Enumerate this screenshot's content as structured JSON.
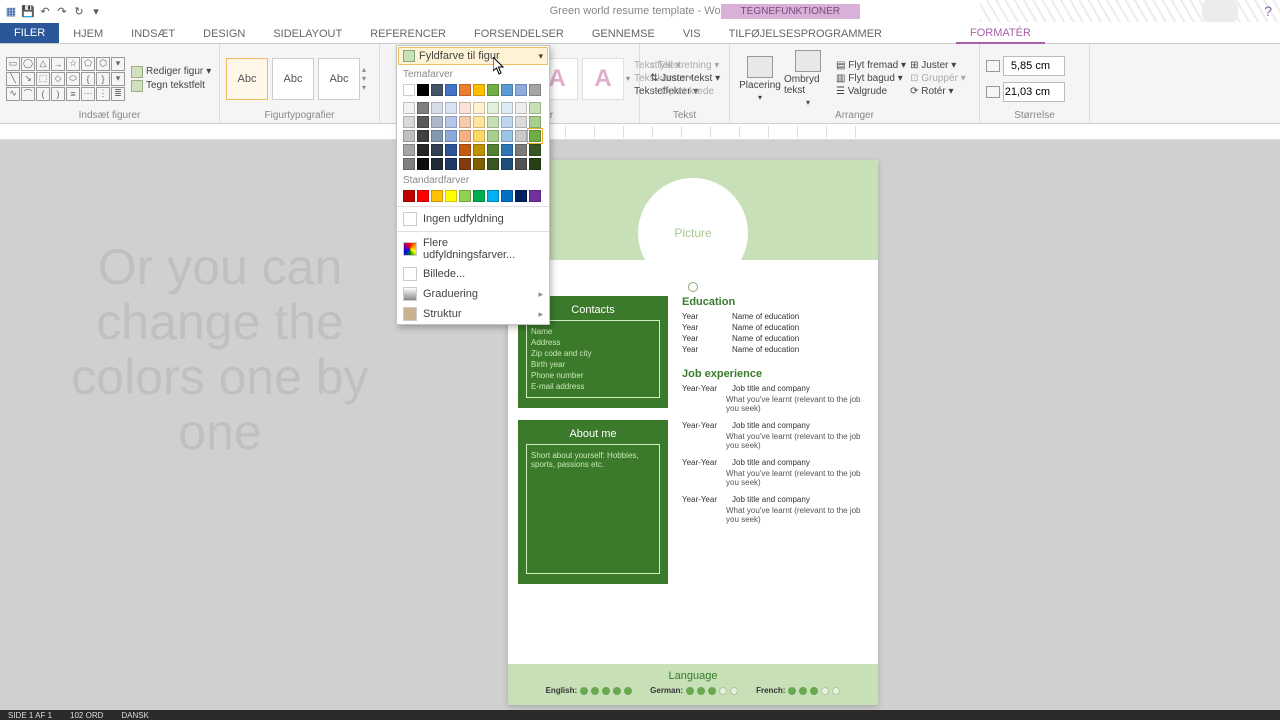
{
  "titlebar": {
    "title": "Green world resume template - Word",
    "context_tab": "TEGNEFUNKTIONER",
    "help": "?"
  },
  "tabs": {
    "file": "FILER",
    "items": [
      "HJEM",
      "INDSÆT",
      "DESIGN",
      "SIDELAYOUT",
      "REFERENCER",
      "FORSENDELSER",
      "GENNEMSE",
      "VIS",
      "TILFØJELSESPROGRAMMER"
    ],
    "active": "FORMATÉR"
  },
  "ribbon": {
    "groups": {
      "insert_shapes": {
        "label": "Indsæt figurer",
        "edit": "Rediger figur",
        "textbox": "Tegn tekstfelt"
      },
      "shape_styles": {
        "label": "Figurtypografier",
        "abc": "Abc"
      },
      "wordart": {
        "label": "WordArt-typografier",
        "glyph": "A",
        "fill": "Tekstfyld",
        "outline": "Tekstkontur",
        "effects": "Teksteffekter"
      },
      "text": {
        "label": "Tekst",
        "direction": "Tekstretning",
        "align": "Juster tekst",
        "link": "Opret kæde"
      },
      "arrange": {
        "label": "Arranger",
        "position": "Placering",
        "wrap": "Ombryd tekst",
        "forward": "Flyt fremad",
        "backward": "Flyt bagud",
        "selection": "Valgrude",
        "alignbtn": "Juster",
        "group": "Gruppér",
        "rotate": "Rotér"
      },
      "size": {
        "label": "Størrelse",
        "h": "5,85 cm",
        "w": "21,03 cm"
      }
    }
  },
  "color_popup": {
    "button": "Fyldfarve til figur",
    "theme_label": "Temafarver",
    "standard_label": "Standardfarver",
    "none": "Ingen udfyldning",
    "more": "Flere udfyldningsfarver...",
    "picture": "Billede...",
    "gradient": "Graduering",
    "texture": "Struktur",
    "theme_row1": [
      "#ffffff",
      "#000000",
      "#44546a",
      "#4472c4",
      "#ed7d31",
      "#ffc000",
      "#70ad47",
      "#5b9bd5",
      "#8faadc",
      "#a5a5a5"
    ],
    "theme_shades": [
      [
        "#f2f2f2",
        "#7f7f7f",
        "#d6dce5",
        "#d9e2f3",
        "#fbe4d5",
        "#fff2cc",
        "#e2efda",
        "#deebf6",
        "#ededed",
        "#c5e0b4"
      ],
      [
        "#d9d9d9",
        "#595959",
        "#adb9ca",
        "#b4c6e7",
        "#f7caac",
        "#ffe599",
        "#c5e0b4",
        "#bdd7ee",
        "#dbdbdb",
        "#a8d08d"
      ],
      [
        "#bfbfbf",
        "#404040",
        "#8496b0",
        "#8eaadb",
        "#f4b183",
        "#ffd966",
        "#a8d08d",
        "#9cc3e5",
        "#c9c9c9",
        "#70ad47"
      ],
      [
        "#a6a6a6",
        "#262626",
        "#323f4f",
        "#2f5496",
        "#c55a11",
        "#bf9000",
        "#538135",
        "#2e75b5",
        "#7b7b7b",
        "#385723"
      ],
      [
        "#808080",
        "#0d0d0d",
        "#222a35",
        "#1f3864",
        "#833c0b",
        "#7f6000",
        "#385723",
        "#1e4e79",
        "#525252",
        "#274117"
      ]
    ],
    "standard": [
      "#c00000",
      "#ff0000",
      "#ffc000",
      "#ffff00",
      "#92d050",
      "#00b050",
      "#00b0f0",
      "#0070c0",
      "#002060",
      "#7030a0"
    ],
    "highlight_index": 29
  },
  "overlay": "Or you can change the colors one by one",
  "doc": {
    "picture": "Picture",
    "contacts": {
      "title": "Contacts",
      "rows": [
        "Name",
        "Address",
        "Zip code and city",
        "Birth year",
        "Phone number",
        "E-mail address"
      ]
    },
    "about": {
      "title": "About me",
      "text": "Short about yourself: Hobbies, sports, passions etc."
    },
    "education": {
      "title": "Education",
      "rows": [
        {
          "year": "Year",
          "name": "Name of education"
        },
        {
          "year": "Year",
          "name": "Name of education"
        },
        {
          "year": "Year",
          "name": "Name of education"
        },
        {
          "year": "Year",
          "name": "Name of education"
        }
      ]
    },
    "experience": {
      "title": "Job experience",
      "rows": [
        {
          "year": "Year-Year",
          "title": "Job title and company",
          "detail": "What you've learnt (relevant to the job you seek)"
        },
        {
          "year": "Year-Year",
          "title": "Job title and company",
          "detail": "What you've learnt (relevant to the job you seek)"
        },
        {
          "year": "Year-Year",
          "title": "Job title and company",
          "detail": "What you've learnt (relevant to the job you seek)"
        },
        {
          "year": "Year-Year",
          "title": "Job title and company",
          "detail": "What you've learnt (relevant to the job you seek)"
        }
      ]
    },
    "language": {
      "title": "Language",
      "items": [
        {
          "name": "English:",
          "score": 5
        },
        {
          "name": "German:",
          "score": 3
        },
        {
          "name": "French:",
          "score": 3
        }
      ]
    }
  },
  "status": {
    "page": "SIDE 1 AF 1",
    "words": "102 ORD",
    "lang": "DANSK"
  },
  "chart_data": {
    "type": "table",
    "title": "Language",
    "categories": [
      "English",
      "German",
      "French"
    ],
    "values": [
      5,
      3,
      3
    ],
    "ylim": [
      0,
      5
    ]
  }
}
